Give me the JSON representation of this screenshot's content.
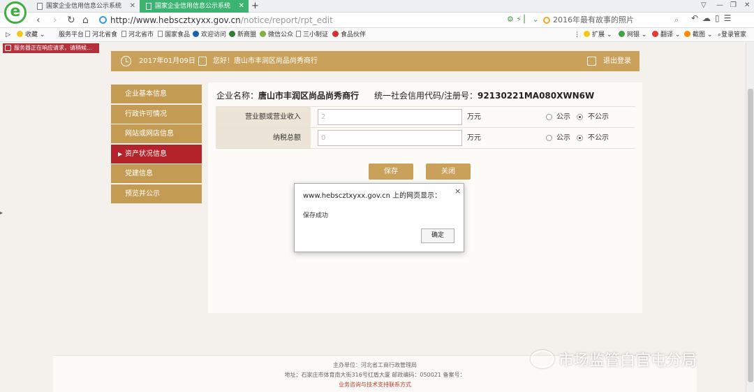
{
  "browser": {
    "logo_letter": "e",
    "tabs": [
      {
        "label": "国家企业信用信息公示系统",
        "active": false
      },
      {
        "label": "国家企业信用信息公示系统",
        "active": true
      }
    ],
    "new_tab": "+",
    "url_host": "http://www.hebscztxyxx.gov.cn",
    "url_path": "/notice/report/rpt_edit",
    "search_text": "2016年最有故事的照片",
    "bookmarks": [
      {
        "label": "收藏"
      },
      {
        "label": "服务平台"
      },
      {
        "label": "河北省食"
      },
      {
        "label": "河北省市"
      },
      {
        "label": "国家食品"
      },
      {
        "label": "欢迎访问"
      },
      {
        "label": "新商盟"
      },
      {
        "label": "微信公众"
      },
      {
        "label": "三小制证"
      },
      {
        "label": "食品伙伴"
      }
    ],
    "right_bookmarks": [
      "扩展",
      "网银",
      "翻译",
      "截图",
      "登录管家"
    ],
    "status_text": "服务器正在响应请求，请稍候..."
  },
  "header": {
    "date": "2017年01月09日",
    "greeting": "您好！唐山市丰润区尚品尚秀商行",
    "logout": "退出登录"
  },
  "sidebar": {
    "items": [
      {
        "label": "企业基本信息",
        "active": false
      },
      {
        "label": "行政许可情况",
        "active": false
      },
      {
        "label": "网站或网店信息",
        "active": false
      },
      {
        "label": "资产状况信息",
        "active": true
      },
      {
        "label": "党建信息",
        "active": false
      },
      {
        "label": "预览并公示",
        "active": false
      }
    ],
    "active_arrow": "▶"
  },
  "company": {
    "name_label": "企业名称：",
    "name": "唐山市丰润区尚品尚秀商行",
    "credit_label": "统一社会信用代码/注册号：",
    "credit_code": "92130221MA080XWN6W"
  },
  "form": {
    "rows": [
      {
        "label": "营业额或营业收入",
        "value": "2",
        "unit": "万元",
        "public": "公示",
        "not_public": "不公示",
        "selected": "not_public"
      },
      {
        "label": "纳税总额",
        "value": "0",
        "unit": "万元",
        "public": "公示",
        "not_public": "不公示",
        "selected": "not_public"
      }
    ],
    "save_label": "保存",
    "close_label": "关闭"
  },
  "dialog": {
    "title": "www.hebscztxyxx.gov.cn 上的网页显示：",
    "close": "×",
    "message": "保存成功",
    "ok_label": "确定"
  },
  "footer": {
    "line1": "主办单位：河北省工商行政管理局",
    "line2": "地址：石家庄市体育南大街316号红盾大厦  邮政编码：050021  备案号：",
    "line3": "业务咨询与技术支持联系方式"
  },
  "watermark": "市场监管白官屯分局",
  "colors": {
    "accent": "#c9a15a",
    "active_red": "#b5232a",
    "tab_green": "#3cb371"
  }
}
